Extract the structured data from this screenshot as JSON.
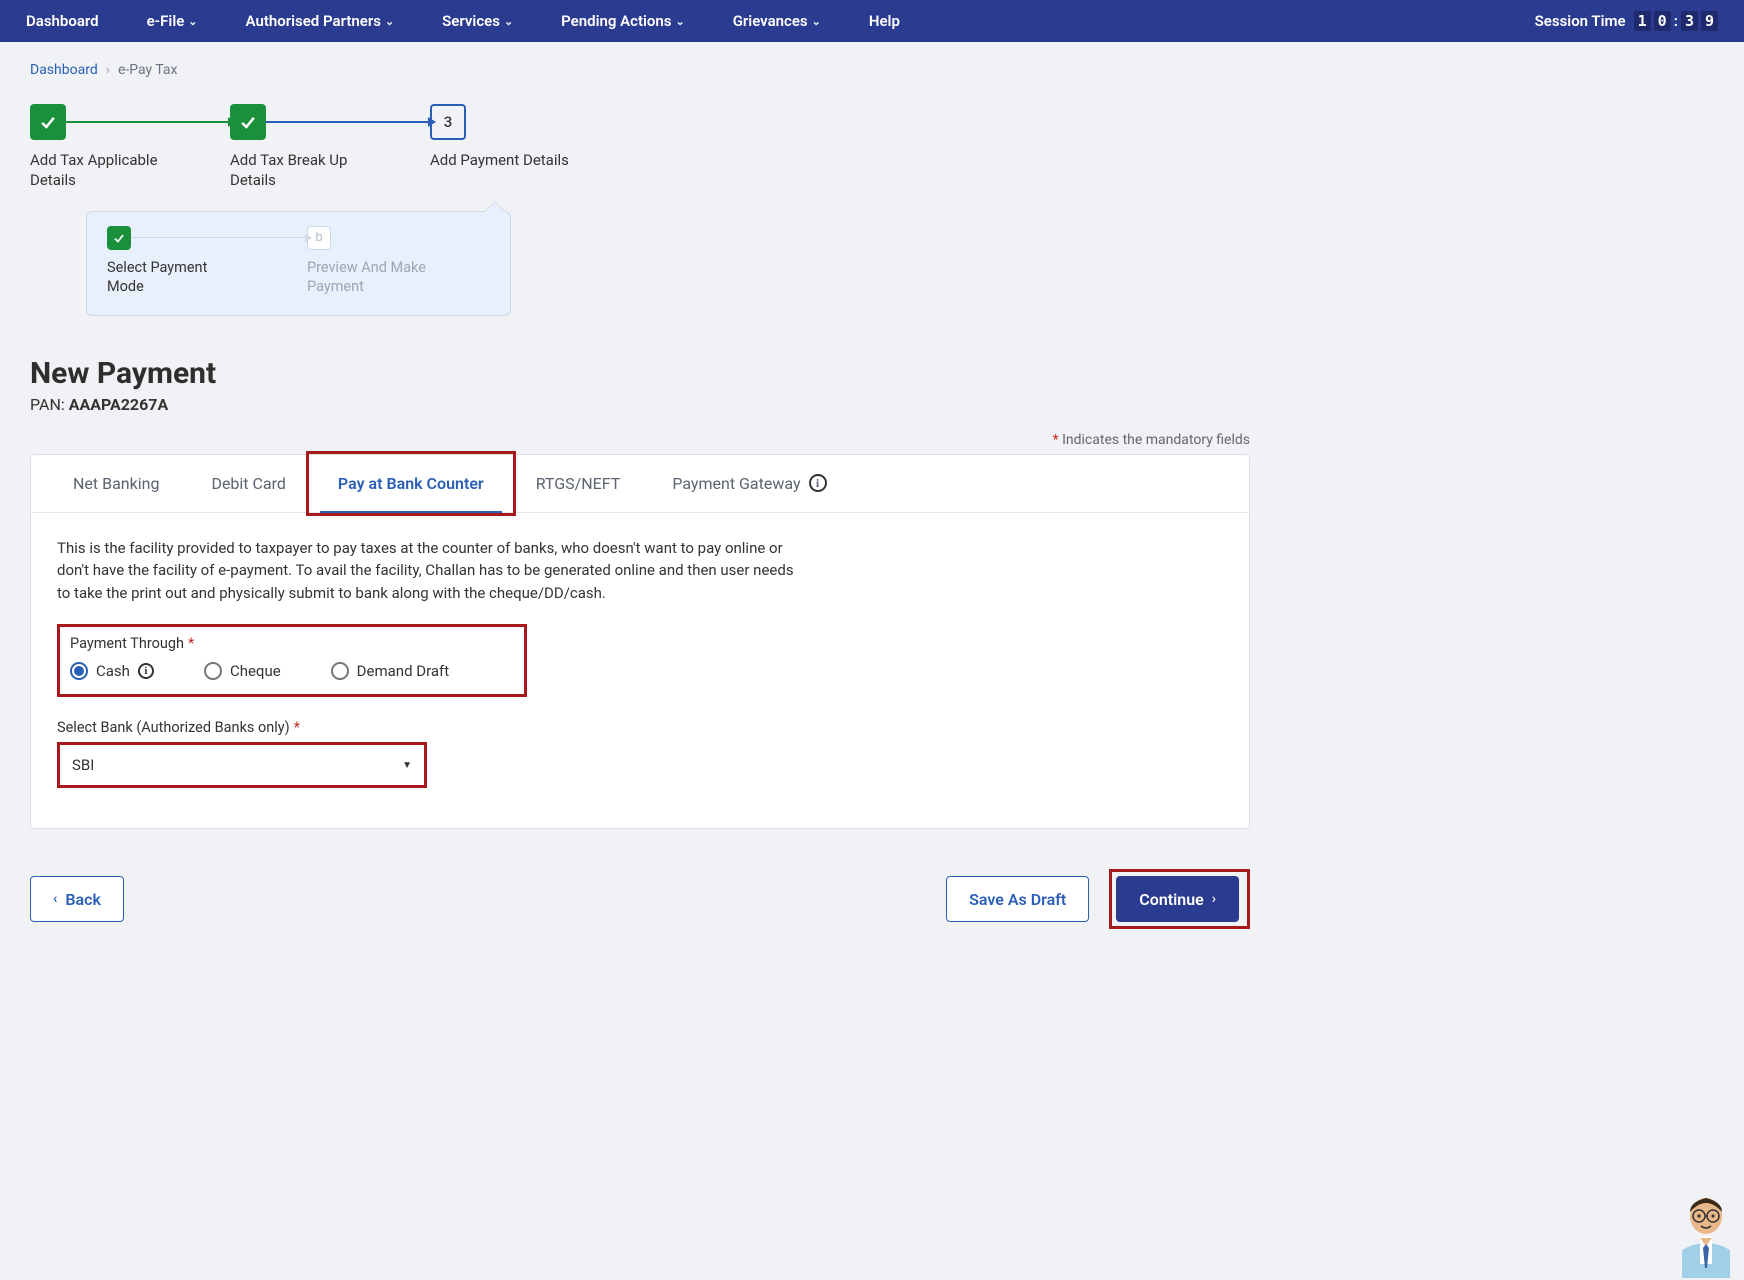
{
  "nav": {
    "items": [
      "Dashboard",
      "e-File",
      "Authorised Partners",
      "Services",
      "Pending Actions",
      "Grievances",
      "Help"
    ],
    "has_dropdown": [
      false,
      true,
      true,
      true,
      true,
      true,
      false
    ],
    "session_label": "Session Time",
    "timer": [
      "1",
      "0",
      "3",
      "9"
    ]
  },
  "breadcrumb": {
    "home": "Dashboard",
    "current": "e-Pay Tax"
  },
  "stepper": {
    "steps": [
      {
        "label": "Add Tax Applicable Details"
      },
      {
        "label": "Add Tax Break Up Details"
      },
      {
        "num": "3",
        "label": "Add Payment Details"
      }
    ],
    "sub": [
      {
        "label": "Select Payment Mode"
      },
      {
        "letter": "b",
        "label": "Preview And Make Payment"
      }
    ]
  },
  "title": "New Payment",
  "pan_label": "PAN:",
  "pan": "AAAPA2267A",
  "mandatory": "Indicates the mandatory fields",
  "tabs": {
    "items": [
      "Net Banking",
      "Debit Card",
      "Pay at Bank Counter",
      "RTGS/NEFT",
      "Payment Gateway"
    ],
    "active_index": 2
  },
  "body": {
    "description": "This is the facility provided to taxpayer to pay taxes at the counter of banks, who doesn't want to pay online or don't have the facility of e-payment. To avail the facility, Challan has to be generated online and then user needs to take the print out and physically submit to bank along with the cheque/DD/cash.",
    "payment_through_label": "Payment Through",
    "radios": [
      "Cash",
      "Cheque",
      "Demand Draft"
    ],
    "radio_selected": 0,
    "bank_label": "Select Bank (Authorized Banks only)",
    "bank_value": "SBI"
  },
  "buttons": {
    "back": "Back",
    "draft": "Save As Draft",
    "continue": "Continue"
  }
}
